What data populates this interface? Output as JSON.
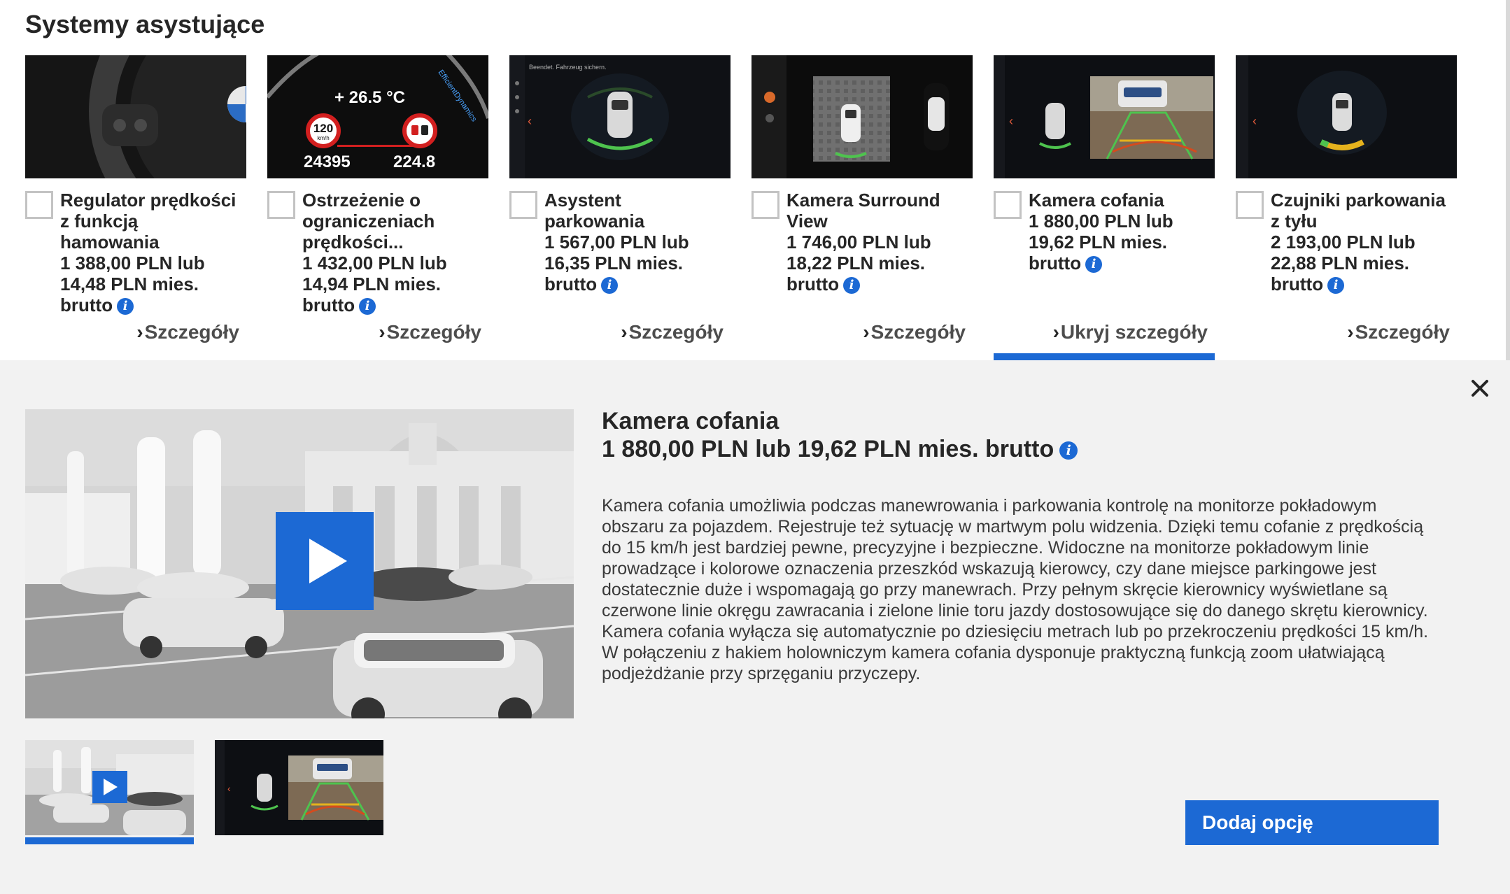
{
  "section": {
    "title": "Systemy asystujące"
  },
  "cards": [
    {
      "name_lines": [
        "Regulator prędkości",
        "z funkcją",
        "hamowania"
      ],
      "price_line": "1 388,00 PLN lub",
      "monthly_line": "14,48 PLN mies.",
      "brutto": "brutto",
      "link": "Szczegóły",
      "thumb_text": []
    },
    {
      "name_lines": [
        "Ostrzeżenie o",
        "ograniczeniach",
        "prędkości..."
      ],
      "price_line": "1 432,00 PLN lub",
      "monthly_line": "14,94 PLN mies.",
      "brutto": "brutto",
      "link": "Szczegóły",
      "thumb_text": [
        "+ 26.5 °C",
        "120",
        "km/h",
        "24395",
        "224.8",
        "EfficientDynamics"
      ]
    },
    {
      "name_lines": [
        "Asystent",
        "parkowania"
      ],
      "price_line": "1 567,00 PLN lub",
      "monthly_line": "16,35 PLN mies.",
      "brutto": "brutto",
      "link": "Szczegóły",
      "thumb_text": [
        "Beendet. Fahrzeug sichern."
      ]
    },
    {
      "name_lines": [
        "Kamera Surround",
        "View"
      ],
      "price_line": "1 746,00 PLN lub",
      "monthly_line": "18,22 PLN mies.",
      "brutto": "brutto",
      "link": "Szczegóły",
      "thumb_text": []
    },
    {
      "name_lines": [
        "Kamera cofania"
      ],
      "price_line": "1 880,00 PLN lub",
      "monthly_line": "19,62 PLN mies.",
      "brutto": "brutto",
      "link": "Ukryj szczegóły",
      "thumb_text": [],
      "active": true
    },
    {
      "name_lines": [
        "Czujniki parkowania",
        "z tyłu"
      ],
      "price_line": "2 193,00 PLN lub",
      "monthly_line": "22,88 PLN mies.",
      "brutto": "brutto",
      "link": "Szczegóły",
      "thumb_text": []
    }
  ],
  "detail": {
    "title": "Kamera cofania",
    "price": "1 880,00 PLN lub 19,62 PLN mies. brutto",
    "description": "Kamera cofania umożliwia podczas manewrowania i parkowania kontrolę na monitorze pokładowym obszaru za pojazdem. Rejestruje też sytuację w martwym polu widzenia. Dzięki temu cofanie z prędkością do 15 km/h jest bardziej pewne, precyzyjne i bezpieczne. Widoczne na monitorze pokładowym linie prowadzące i kolorowe oznaczenia przeszkód wskazują kierowcy, czy dane miejsce parkingowe jest dostatecznie duże i wspomagają go przy manewrach. Przy pełnym skręcie kierownicy wyświetlane są czerwone linie okręgu zawracania i zielone linie toru jazdy dostosowujące się do danego skrętu kierownicy. Kamera cofania wyłącza się automatycznie po dziesięciu metrach lub po przekroczeniu prędkości 15 km/h. W połączeniu z hakiem holowniczym kamera cofania dysponuje praktyczną funkcją zoom ułatwiającą podjeżdżanie przy sprzęganiu przyczepy.",
    "add_button": "Dodaj opcję",
    "close_icon": "close-icon",
    "info_icon": "i"
  },
  "colors": {
    "accent": "#1c69d4",
    "panel_bg": "#f2f2f2",
    "text": "#262626"
  }
}
